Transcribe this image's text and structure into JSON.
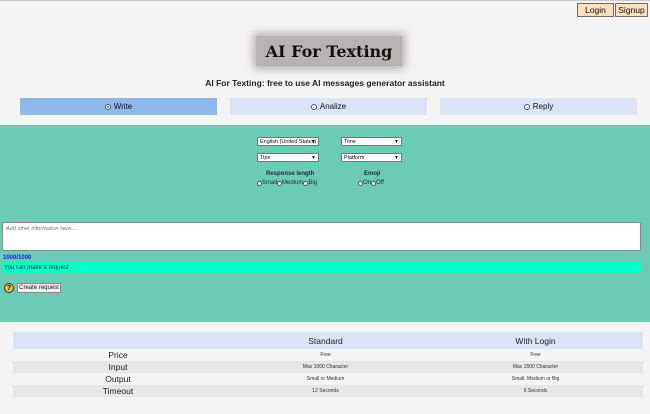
{
  "header": {
    "login_label": "Login",
    "signup_label": "Signup"
  },
  "logo": {
    "text": "AI For Texting"
  },
  "subtitle": "AI For Texting: free to use AI messages generator assistant",
  "modes": [
    {
      "label": "Write",
      "selected": true
    },
    {
      "label": "Analize",
      "selected": false
    },
    {
      "label": "Reply",
      "selected": false
    }
  ],
  "form": {
    "language": "English (United States)",
    "tone": "Tone",
    "tips": "Tips",
    "platform": "Platform",
    "response_length_label": "Response length",
    "response_length_options": [
      "Small",
      "Medium",
      "Big"
    ],
    "emoji_label": "Emoji",
    "emoji_options": [
      "On",
      "Off"
    ],
    "info_placeholder": "Add other information here.....",
    "char_counter": "1000/1000",
    "status": "You can make a request",
    "create_button": "Create request",
    "help_icon": "?"
  },
  "pricing": {
    "headers": [
      "",
      "Standard",
      "With Login"
    ],
    "rows": [
      {
        "label": "Price",
        "standard": "Free",
        "login": "Free"
      },
      {
        "label": "Input",
        "standard": "Max 1000 Character",
        "login": "Max 1500 Character"
      },
      {
        "label": "Output",
        "standard": "Small or Medium",
        "login": "Small, Medium or Big"
      },
      {
        "label": "Timeout",
        "standard": "12 Seconds",
        "login": "6 Seconds"
      }
    ]
  },
  "colors": {
    "panel": "#6bcbb5",
    "status_bar": "#05ffc8",
    "active_tab": "#8fb9e9",
    "tab": "#dbe4f6",
    "auth_button": "#fadfc0",
    "counter": "#1b24e0"
  }
}
